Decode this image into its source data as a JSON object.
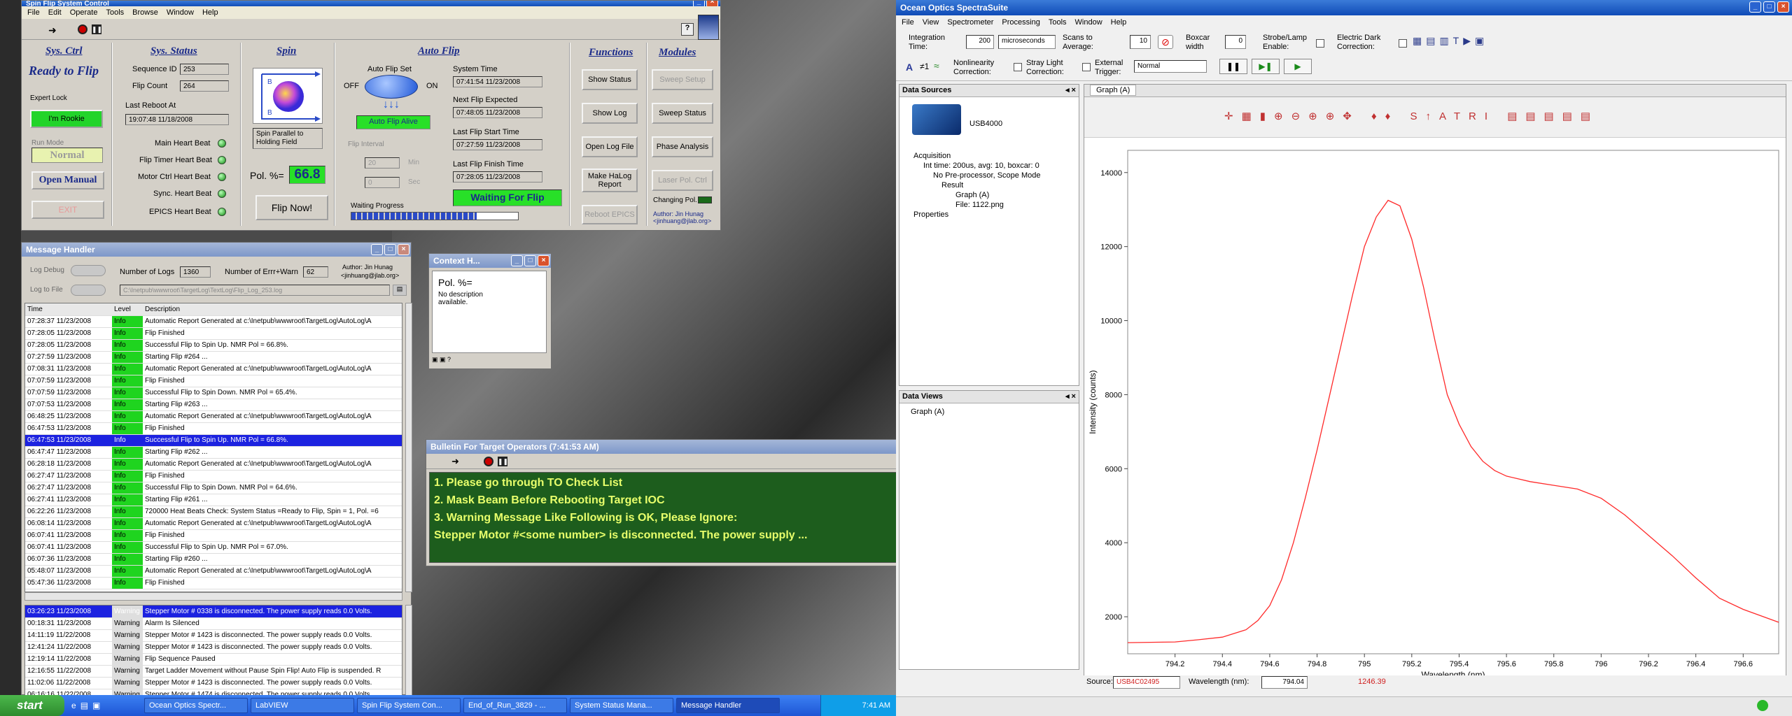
{
  "spin_window": {
    "title": "Spin Flip System Control",
    "menu": [
      "File",
      "Edit",
      "Operate",
      "Tools",
      "Browse",
      "Window",
      "Help"
    ],
    "sys_ctrl": {
      "heading": "Sys. Ctrl",
      "state": "Ready to Flip",
      "expert_lock_label": "Expert Lock",
      "expert_btn": "I'm Rookie",
      "run_mode_label": "Run Mode",
      "run_mode": "Normal",
      "open_manual": "Open Manual",
      "exit": "EXIT"
    },
    "sys_status": {
      "heading": "Sys. Status",
      "sequence_id_label": "Sequence ID",
      "sequence_id": "253",
      "flip_count_label": "Flip Count",
      "flip_count": "264",
      "last_reboot_label": "Last Reboot At",
      "last_reboot": "19:07:48 11/18/2008",
      "heartbeats": [
        "Main Heart Beat",
        "Flip Timer Heart Beat",
        "Motor Ctrl Heart Beat",
        "Sync. Heart Beat",
        "EPICS Heart Beat"
      ]
    },
    "spin": {
      "heading": "Spin",
      "status": "Spin Parallel to Holding Field",
      "pol_label": "Pol. %=",
      "pol": "66.8",
      "flip_now": "Flip Now!"
    },
    "auto_flip": {
      "heading": "Auto Flip",
      "set_label": "Auto Flip Set",
      "off": "OFF",
      "on": "ON",
      "alive": "Auto Flip Alive",
      "interval_label": "Flip Interval",
      "min_val": "20",
      "min_unit": "Min",
      "sec_val": "0",
      "sec_unit": "Sec",
      "progress_label": "Waiting Progress",
      "progress": 0.75,
      "system_time_label": "System Time",
      "system_time": "07:41:54 11/23/2008",
      "next_flip_label": "Next Flip Expected",
      "next_flip": "07:48:05 11/23/2008",
      "last_start_label": "Last Flip Start Time",
      "last_start": "07:27:59 11/23/2008",
      "last_finish_label": "Last Flip Finish Time",
      "last_finish": "07:28:05 11/23/2008",
      "waiting": "Waiting For Flip"
    },
    "functions": {
      "heading": "Functions",
      "buttons": [
        "Show Status",
        "Show Log",
        "Open Log File",
        "Make HaLog Report",
        "Reboot EPICS"
      ]
    },
    "modules": {
      "heading": "Modules",
      "buttons": [
        "Sweep Setup",
        "Sweep Status",
        "Phase Analysis",
        "Laser Pol. Ctrl"
      ],
      "changing_pol": "Changing Pol.",
      "author": "Author: Jin Hunag",
      "email": "<jinhuang@jlab.org>"
    }
  },
  "message_window": {
    "title": "Message Handler",
    "log_debug": "Log Debug",
    "log_file": "Log to File",
    "num_logs_label": "Number of Logs",
    "num_logs": "1360",
    "num_err_label": "Number of Errr+Warn",
    "num_err": "62",
    "author": "Author: Jin Hunag",
    "email": "<jinhuang@jlab.org>",
    "path": "C:\\Inetpub\\wwwroot\\TargetLog\\TextLog\\Flip_Log_253.log",
    "columns": [
      "Time",
      "Level",
      "Description"
    ],
    "rows": [
      [
        "07:28:37 11/23/2008",
        "Info",
        "Automatic Report Generated at c:\\Inetpub\\wwwroot\\TargetLog\\AutoLog\\A"
      ],
      [
        "07:28:05 11/23/2008",
        "Info",
        "Flip Finished"
      ],
      [
        "07:28:05 11/23/2008",
        "Info",
        "Successful Flip to Spin Up. NMR Pol = 66.8%."
      ],
      [
        "07:27:59 11/23/2008",
        "Info",
        "Starting Flip #264 ..."
      ],
      [
        "07:08:31 11/23/2008",
        "Info",
        "Automatic Report Generated at c:\\Inetpub\\wwwroot\\TargetLog\\AutoLog\\A"
      ],
      [
        "07:07:59 11/23/2008",
        "Info",
        "Flip Finished"
      ],
      [
        "07:07:59 11/23/2008",
        "Info",
        "Successful Flip to Spin Down. NMR Pol = 65.4%."
      ],
      [
        "07:07:53 11/23/2008",
        "Info",
        "Starting Flip #263 ..."
      ],
      [
        "06:48:25 11/23/2008",
        "Info",
        "Automatic Report Generated at c:\\Inetpub\\wwwroot\\TargetLog\\AutoLog\\A"
      ],
      [
        "06:47:53 11/23/2008",
        "Info",
        "Flip Finished"
      ],
      [
        "06:47:53 11/23/2008",
        "Info",
        "Successful Flip to Spin Up. NMR Pol = 66.8%."
      ],
      [
        "06:47:47 11/23/2008",
        "Info",
        "Starting Flip #262 ..."
      ],
      [
        "06:28:18 11/23/2008",
        "Info",
        "Automatic Report Generated at c:\\Inetpub\\wwwroot\\TargetLog\\AutoLog\\A"
      ],
      [
        "06:27:47 11/23/2008",
        "Info",
        "Flip Finished"
      ],
      [
        "06:27:47 11/23/2008",
        "Info",
        "Successful Flip to Spin Down. NMR Pol = 64.6%."
      ],
      [
        "06:27:41 11/23/2008",
        "Info",
        "Starting Flip #261 ..."
      ],
      [
        "06:22:26 11/23/2008",
        "Info",
        "720000 Heat Beats Check: System Status =Ready to Flip, Spin = 1, Pol. =6"
      ],
      [
        "06:08:14 11/23/2008",
        "Info",
        "Automatic Report Generated at c:\\Inetpub\\wwwroot\\TargetLog\\AutoLog\\A"
      ],
      [
        "06:07:41 11/23/2008",
        "Info",
        "Flip Finished"
      ],
      [
        "06:07:41 11/23/2008",
        "Info",
        "Successful Flip to Spin Up. NMR Pol = 67.0%."
      ],
      [
        "06:07:36 11/23/2008",
        "Info",
        "Starting Flip #260 ..."
      ],
      [
        "05:48:07 11/23/2008",
        "Info",
        "Automatic Report Generated at c:\\Inetpub\\wwwroot\\TargetLog\\AutoLog\\A"
      ],
      [
        "05:47:36 11/23/2008",
        "Info",
        "Flip Finished"
      ]
    ],
    "warn_rows": [
      [
        "03:26:23 11/23/2008",
        "Warning",
        "Stepper Motor # 0338 is disconnected. The power supply reads 0.0 Volts."
      ],
      [
        "00:18:31 11/23/2008",
        "Warning",
        "Alarm Is Silenced"
      ],
      [
        "14:11:19 11/22/2008",
        "Warning",
        "Stepper Motor # 1423 is disconnected. The power supply reads 0.0 Volts."
      ],
      [
        "12:41:24 11/22/2008",
        "Warning",
        "Stepper Motor # 1423 is disconnected. The power supply reads 0.0 Volts."
      ],
      [
        "12:19:14 11/22/2008",
        "Warning",
        "Flip Sequence Paused"
      ],
      [
        "12:16:55 11/22/2008",
        "Warning",
        "Target Ladder Movement without Pause Spin Flip! Auto Flip is suspended. R"
      ],
      [
        "11:02:06 11/22/2008",
        "Warning",
        "Stepper Motor # 1423 is disconnected. The power supply reads 0.0 Volts."
      ],
      [
        "06:16:16 11/22/2008",
        "Warning",
        "Stepper Motor # 1474 is disconnected. The power supply reads 0.0 Volts."
      ]
    ]
  },
  "context_window": {
    "title": "Context H...",
    "heading": "Pol. %=",
    "body": "No description available."
  },
  "bulletin": {
    "title": "Bulletin For Target Operators (7:41:53 AM)",
    "lines": [
      "1. Please go through TO Check List",
      "2. Mask Beam Before Rebooting Target IOC",
      "3. Warning Message Like Following is OK, Please Ignore:",
      " Stepper Motor #<some number> is disconnected. The power supply ..."
    ]
  },
  "ocean": {
    "title": "Ocean Optics SpectraSuite",
    "menu": [
      "File",
      "View",
      "Spectrometer",
      "Processing",
      "Tools",
      "Window",
      "Help"
    ],
    "int_time_label": "Integration Time:",
    "int_time": "200",
    "int_unit": "microseconds",
    "scans_label": "Scans to Average:",
    "scans": "10",
    "boxcar_label": "Boxcar width",
    "boxcar": "0",
    "strobe_label": "Strobe/Lamp Enable:",
    "dark_label": "Electric Dark Correction:",
    "nonlin_label": "Nonlinearity Correction:",
    "stray_label": "Stray Light Correction:",
    "ext_trig_label": "External Trigger:",
    "trigger_mode": "Normal",
    "data_sources": "Data Sources",
    "device": "USB4000",
    "acq": "Acquisition",
    "acq_params": "Int time: 200us, avg: 10, boxcar: 0",
    "preproc": "No Pre-processor, Scope Mode",
    "result": "Result",
    "graph_item": "Graph (A)",
    "file_item": "File: 1122.png",
    "properties": "Properties",
    "data_views": "Data Views",
    "view_item": "Graph (A)",
    "graph_tab": "Graph (A)",
    "source_label": "Source:",
    "source": "USB4C02495",
    "wavelength_label": "Wavelength (nm):",
    "wavelength": "794.04",
    "readout": "1246.39"
  },
  "chart_data": {
    "type": "line",
    "xlabel": "Wavelength (nm)",
    "ylabel": "Intensity (counts)",
    "xlim": [
      794.0,
      796.75
    ],
    "ylim": [
      1000,
      14600
    ],
    "xticks": [
      794.2,
      794.4,
      794.6,
      794.8,
      795,
      795.2,
      795.4,
      795.6,
      795.8,
      796,
      796.2,
      796.4,
      796.6
    ],
    "xtick_labels": [
      "794.2",
      "794.4",
      "794.6",
      "794.8",
      "795",
      "795.2",
      "795.4",
      "795.6",
      "795.8",
      "796",
      "796.2",
      "796.4",
      "796.6"
    ],
    "yticks": [
      2000,
      4000,
      6000,
      8000,
      10000,
      12000,
      14000
    ],
    "ytick_labels": [
      "2000",
      "4000",
      "6000",
      "8000",
      "10000",
      "12000",
      "14000"
    ],
    "line_color": "#ff2a2a",
    "x": [
      794.0,
      794.2,
      794.3,
      794.4,
      794.5,
      794.55,
      794.6,
      794.65,
      794.7,
      794.75,
      794.8,
      794.85,
      794.9,
      794.95,
      795.0,
      795.05,
      795.1,
      795.15,
      795.2,
      795.25,
      795.3,
      795.35,
      795.4,
      795.45,
      795.5,
      795.55,
      795.6,
      795.7,
      795.8,
      795.9,
      796.0,
      796.1,
      796.2,
      796.3,
      796.4,
      796.5,
      796.6,
      796.75
    ],
    "y": [
      1300,
      1320,
      1380,
      1450,
      1650,
      1900,
      2300,
      3000,
      4000,
      5200,
      6500,
      7900,
      9300,
      10700,
      12000,
      12800,
      13250,
      13100,
      12200,
      10900,
      9400,
      8000,
      7200,
      6600,
      6200,
      5950,
      5800,
      5650,
      5550,
      5450,
      5200,
      4750,
      4200,
      3650,
      3050,
      2500,
      2200,
      1850
    ]
  },
  "taskbar": {
    "start": "start",
    "items": [
      "Ocean Optics Spectr...",
      "LabVIEW",
      "Spin Flip System Con...",
      "End_of_Run_3829 - ...",
      "System Status Mana...",
      "Message Handler"
    ],
    "clock": "7:41 AM"
  }
}
